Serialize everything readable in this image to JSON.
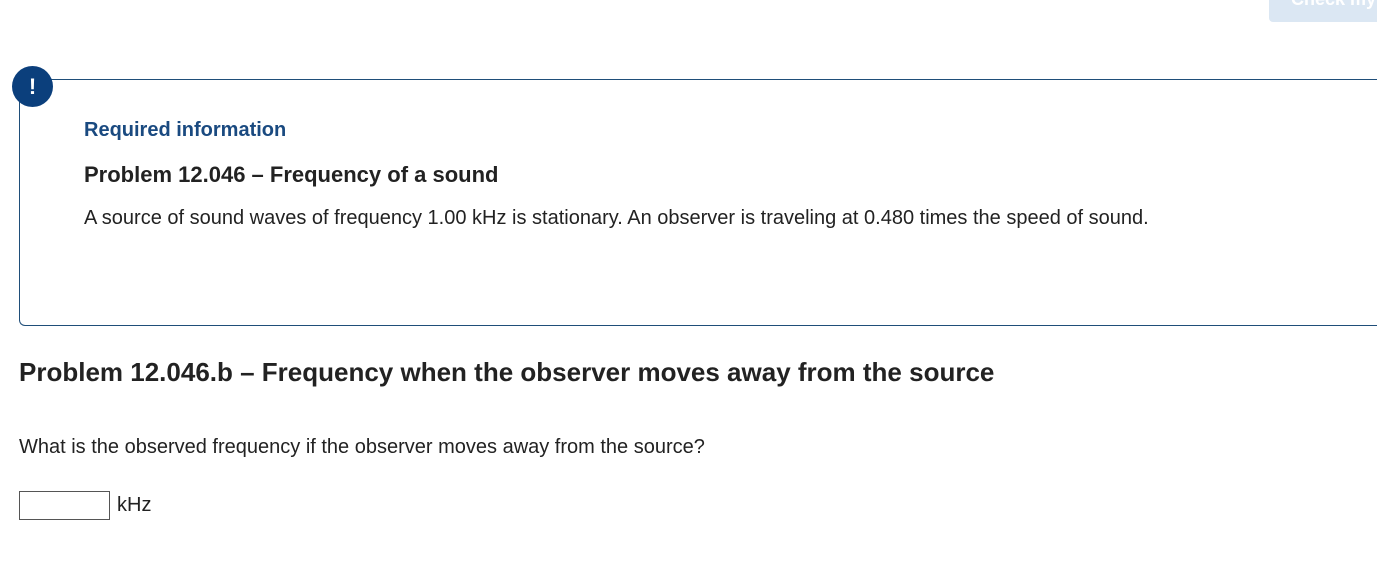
{
  "header": {
    "check_button_label": "Check my work"
  },
  "alert": {
    "icon_glyph": "!"
  },
  "info_box": {
    "heading": "Required information",
    "problem_title": "Problem 12.046 – Frequency of a sound",
    "problem_text": "A source of sound waves of frequency 1.00 kHz is stationary. An observer is traveling at 0.480 times the speed of sound."
  },
  "part": {
    "title": "Problem 12.046.b – Frequency when the observer moves away from the source",
    "question": "What is the observed frequency if the observer moves away from the source?",
    "answer_value": "",
    "unit": "kHz"
  },
  "colors": {
    "accent": "#0b3f7c",
    "heading_blue": "#1a4a80",
    "button_bg": "#dbe7f3"
  }
}
